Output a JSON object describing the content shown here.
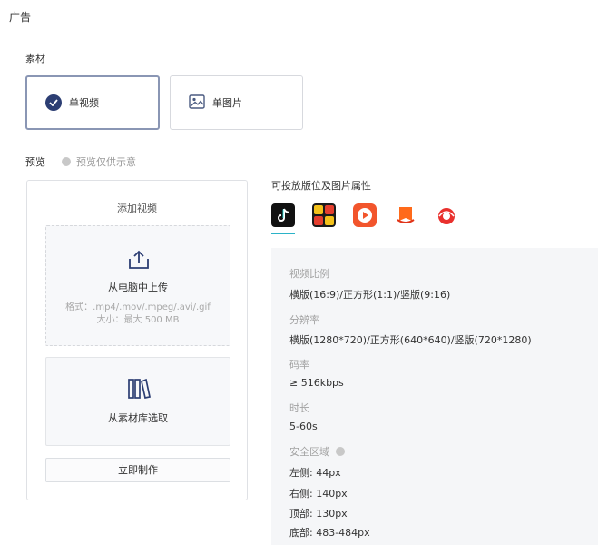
{
  "section": {
    "title": "广告"
  },
  "material": {
    "label": "素材",
    "options": [
      {
        "label": "单视频",
        "selected": true,
        "icon": "check-circle-icon"
      },
      {
        "label": "单图片",
        "selected": false,
        "icon": "image-icon"
      }
    ]
  },
  "preview": {
    "label": "预览",
    "hint": "预览仅供示意"
  },
  "upload": {
    "title": "添加视频",
    "drop_main": "从电脑中上传",
    "drop_formats": "格式：.mp4/.mov/.mpeg/.avi/.gif",
    "drop_size": "大小：最大 500 MB",
    "library_label": "从素材库选取",
    "make_button": "立即制作"
  },
  "placements": {
    "title": "可投放版位及图片属性",
    "platforms": [
      {
        "icon": "tiktok-icon",
        "color": "#111111",
        "active": true
      },
      {
        "icon": "app-puzzle-icon",
        "color": "#f4c21b",
        "active": false
      },
      {
        "icon": "video-play-icon",
        "color": "#f2552c",
        "active": false
      },
      {
        "icon": "reader-bookmark-icon",
        "color": "#ff6a1a",
        "active": false
      },
      {
        "icon": "red-app-icon",
        "color": "#e9302d",
        "active": false
      }
    ],
    "specs": [
      {
        "label": "视频比例",
        "value": "横版(16:9)/正方形(1:1)/竖版(9:16)"
      },
      {
        "label": "分辨率",
        "value": "横版(1280*720)/正方形(640*640)/竖版(720*1280)"
      },
      {
        "label": "码率",
        "value": "≥ 516kbps"
      },
      {
        "label": "时长",
        "value": "5-60s"
      }
    ],
    "safe_area": {
      "label": "安全区域",
      "items": [
        "左侧: 44px",
        "右侧: 140px",
        "顶部: 130px",
        "底部: 483-484px"
      ]
    }
  }
}
